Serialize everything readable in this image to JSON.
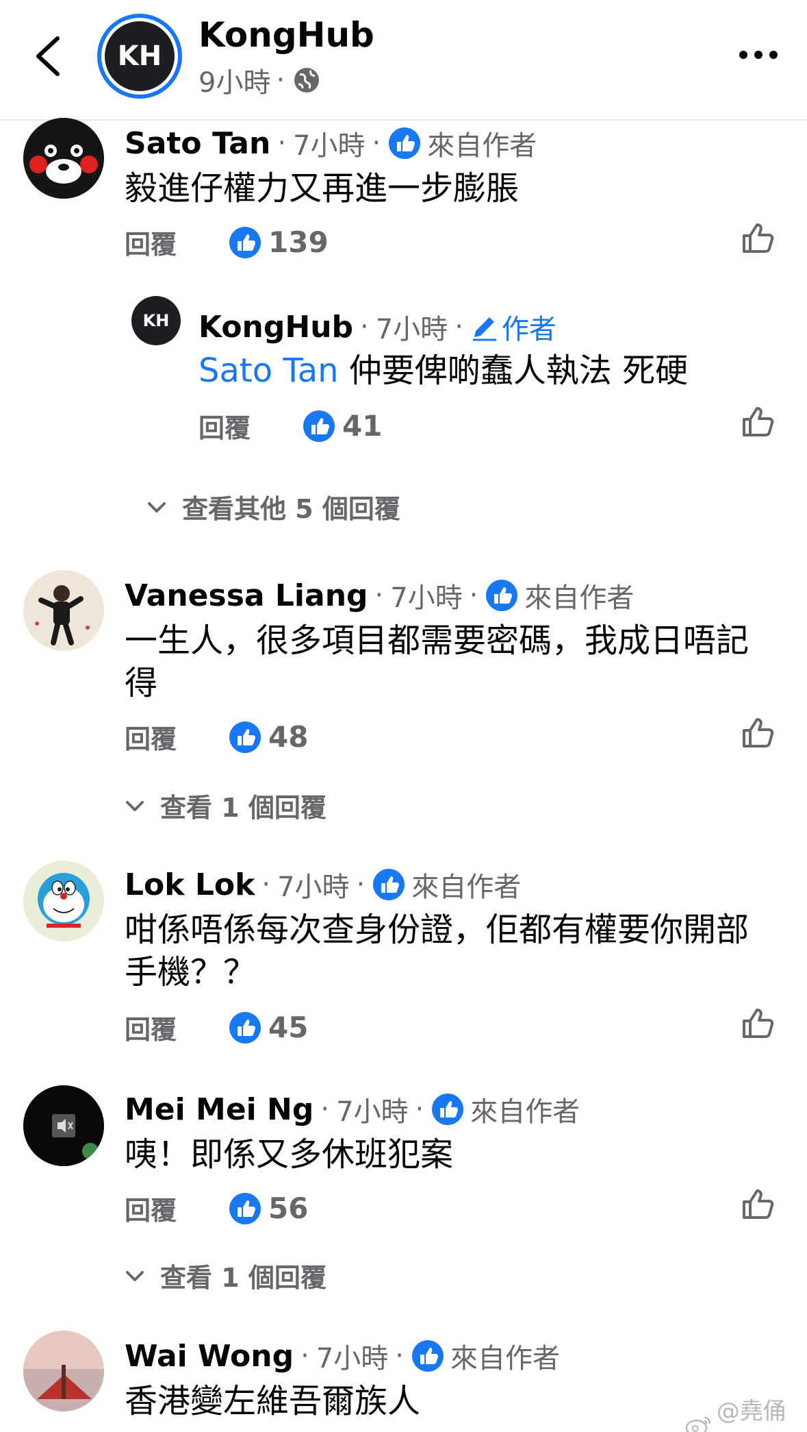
{
  "header": {
    "page_name": "KongHub",
    "avatar_text": "KH",
    "post_time": "9小時",
    "dot": "·"
  },
  "labels": {
    "dot": "·",
    "top_fan": "來自作者",
    "author": "作者",
    "reply": "回覆"
  },
  "comments": [
    {
      "name": "Sato Tan",
      "time": "7小時",
      "text": "毅進仔權力又再進一步膨脹",
      "likes": "139",
      "reply_thread": {
        "name": "KongHub",
        "avatar_text": "KH",
        "time": "7小時",
        "mention": "Sato Tan",
        "text": " 仲要俾啲蠢人執法 死硬",
        "likes": "41"
      },
      "view_replies": "查看其他 5 個回覆"
    },
    {
      "name": "Vanessa Liang",
      "time": "7小時",
      "text": "一生人，很多項目都需要密碼，我成日唔記得",
      "likes": "48",
      "view_replies": "查看 1 個回覆"
    },
    {
      "name": "Lok Lok",
      "time": "7小時",
      "text": "咁係唔係每次查身份證，佢都有權要你開部手機？？",
      "likes": "45"
    },
    {
      "name": "Mei Mei Ng",
      "time": "7小時",
      "text": "咦！即係又多休班犯案",
      "likes": "56",
      "view_replies": "查看 1 個回覆"
    },
    {
      "name": "Wai Wong",
      "time": "7小時",
      "text": "香港變左維吾爾族人"
    }
  ],
  "watermark": "@堯俑澍",
  "colors": {
    "accent": "#1877f2",
    "secondary_text": "#65676b",
    "primary_text": "#050505",
    "divider": "#e4e6eb"
  },
  "icons": [
    "back-chevron-icon",
    "globe-icon",
    "more-icon",
    "top-fan-like-icon",
    "like-reaction-icon",
    "like-outline-icon",
    "edit-pencil-icon",
    "chevron-down-icon",
    "weibo-icon"
  ]
}
